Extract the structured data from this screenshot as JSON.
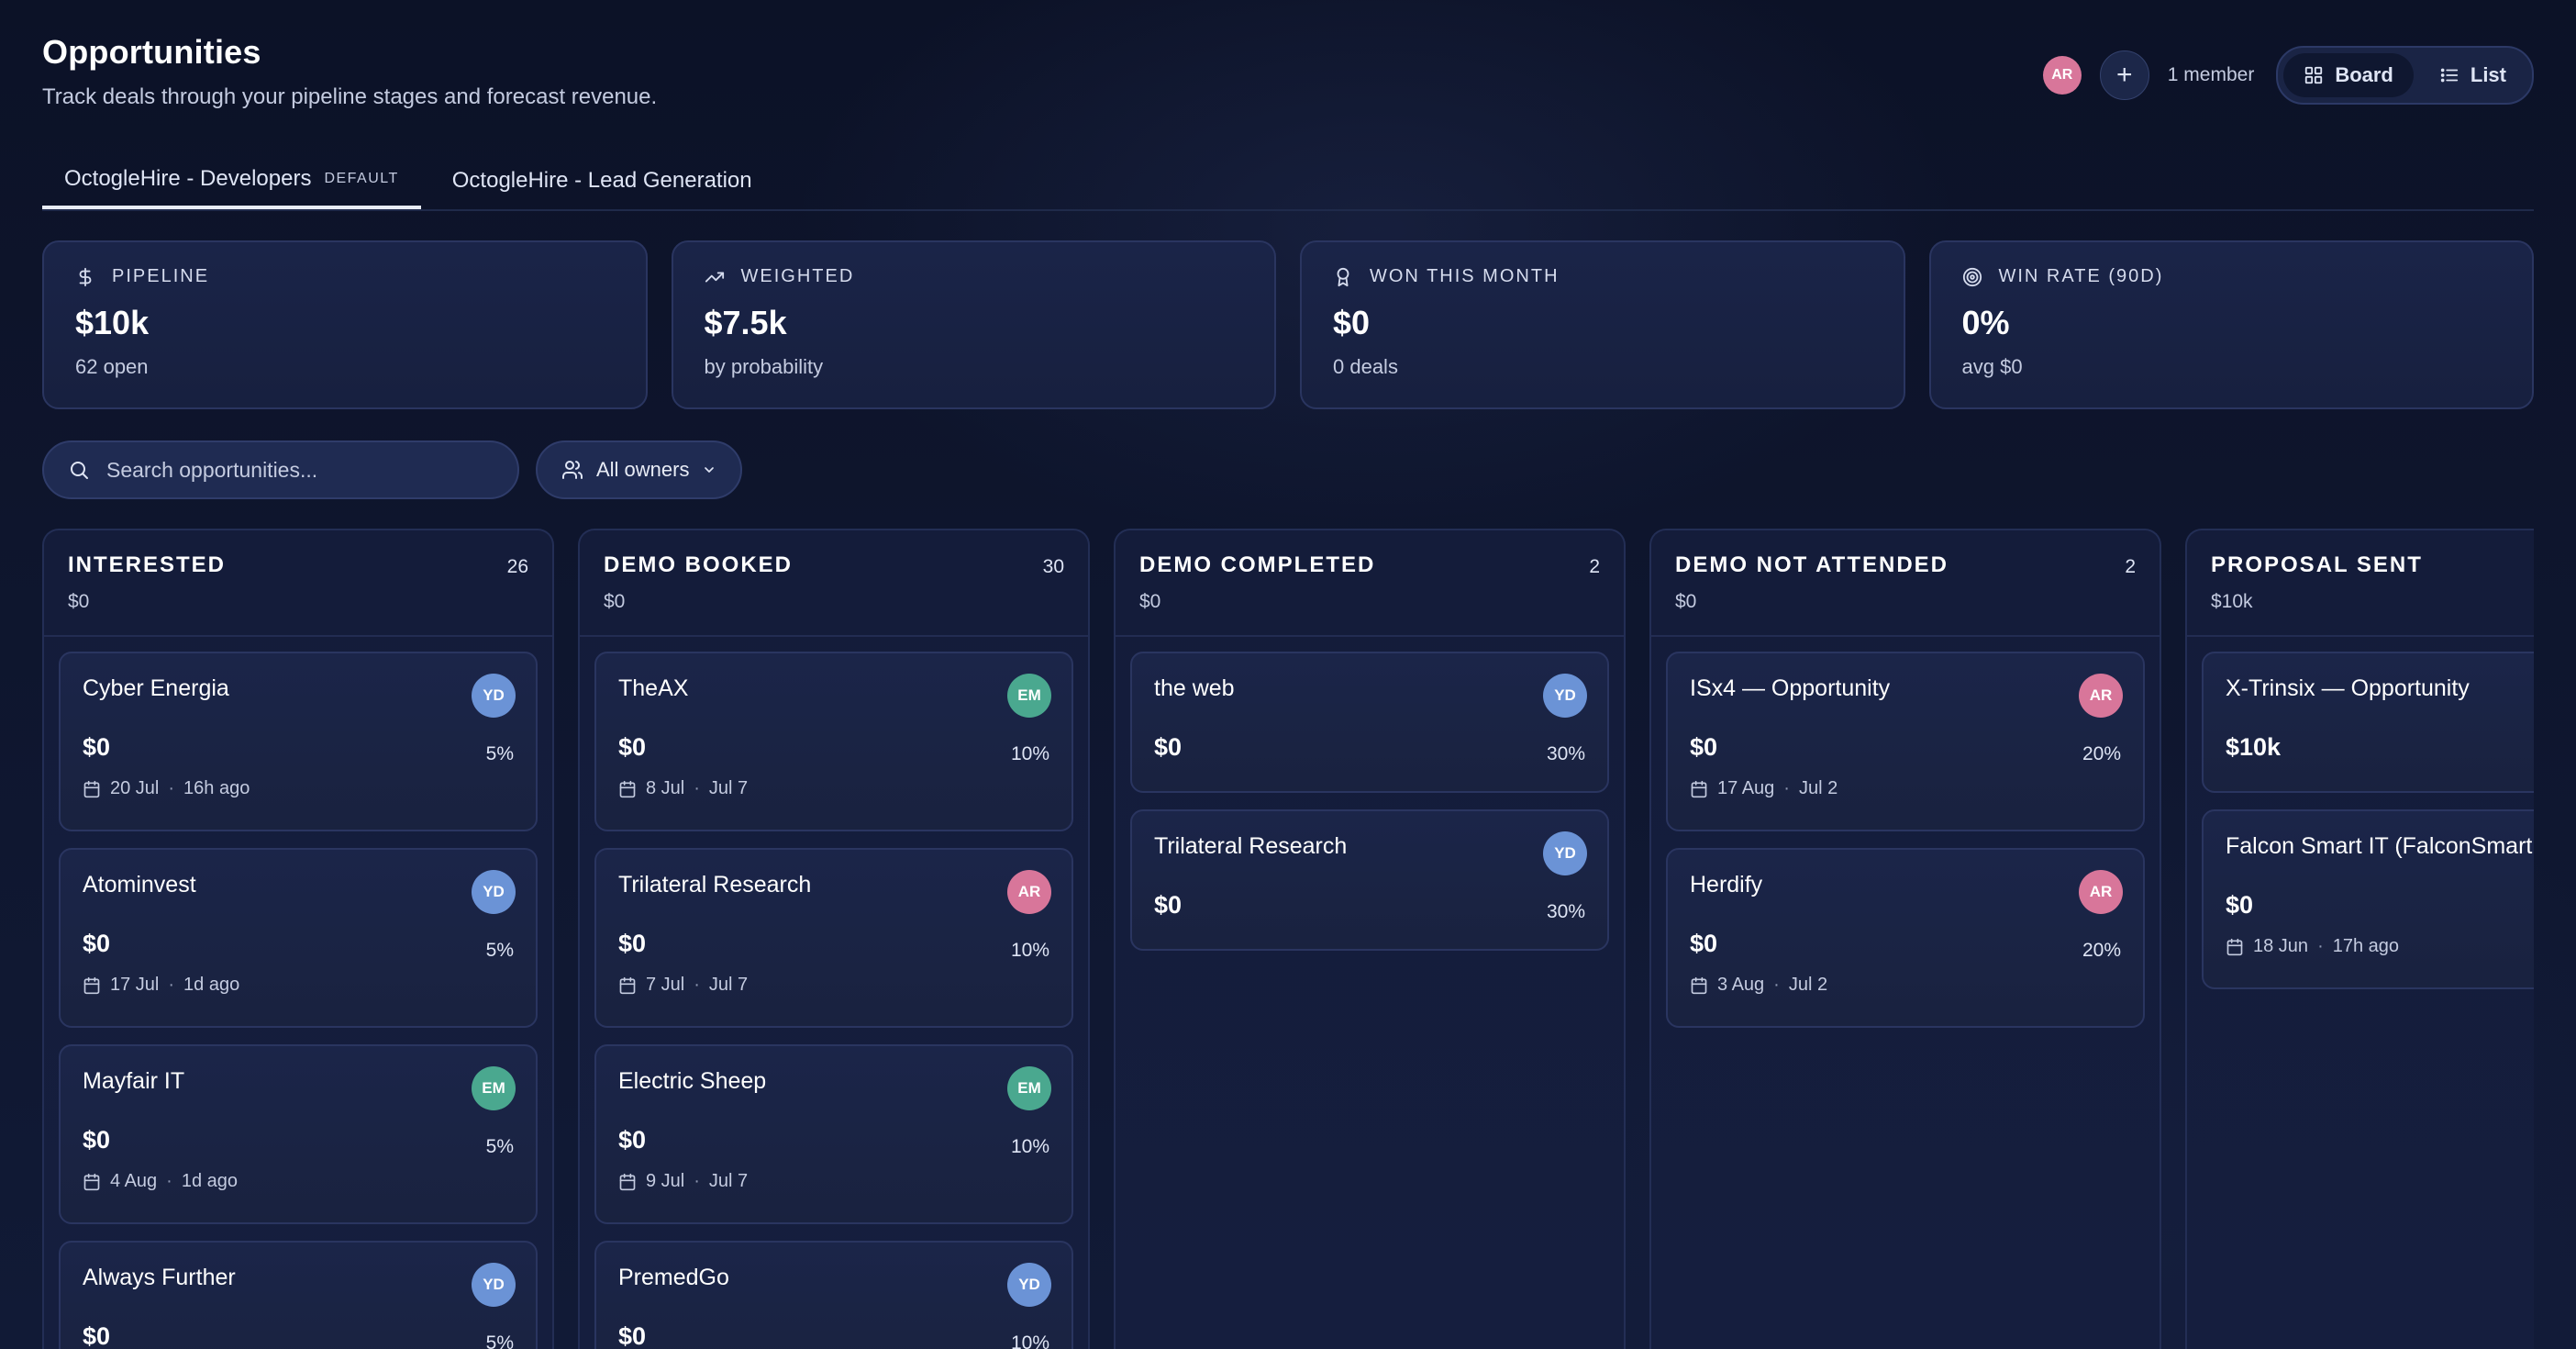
{
  "header": {
    "title": "Opportunities",
    "subtitle": "Track deals through your pipeline stages and forecast revenue.",
    "avatar": "AR",
    "add_member_label": "+",
    "member_count": "1 member",
    "views": {
      "board": "Board",
      "list": "List",
      "active": "board"
    }
  },
  "tabs": [
    {
      "label": "OctogleHire - Developers",
      "badge": "DEFAULT",
      "active": true
    },
    {
      "label": "OctogleHire - Lead Generation",
      "badge": "",
      "active": false
    }
  ],
  "stats": [
    {
      "icon": "dollar-icon",
      "label": "PIPELINE",
      "value": "$10k",
      "sub": "62 open"
    },
    {
      "icon": "trending-up-icon",
      "label": "WEIGHTED",
      "value": "$7.5k",
      "sub": "by probability"
    },
    {
      "icon": "award-icon",
      "label": "WON THIS MONTH",
      "value": "$0",
      "sub": "0 deals"
    },
    {
      "icon": "target-icon",
      "label": "WIN RATE (90D)",
      "value": "0%",
      "sub": "avg $0"
    }
  ],
  "filters": {
    "search_placeholder": "Search opportunities...",
    "owner_filter": "All owners"
  },
  "colors": {
    "AR": "#d8769a",
    "YD": "#6b93d6",
    "EM": "#4aa88f"
  },
  "columns": [
    {
      "title": "INTERESTED",
      "count": "26",
      "total": "$0",
      "cards": [
        {
          "title": "Cyber Energia",
          "owner": "YD",
          "amount": "$0",
          "prob": "5%",
          "date": "20 Jul",
          "meta": "16h ago"
        },
        {
          "title": "Atominvest",
          "owner": "YD",
          "amount": "$0",
          "prob": "5%",
          "date": "17 Jul",
          "meta": "1d ago"
        },
        {
          "title": "Mayfair IT",
          "owner": "EM",
          "amount": "$0",
          "prob": "5%",
          "date": "4 Aug",
          "meta": "1d ago"
        },
        {
          "title": "Always Further",
          "owner": "YD",
          "amount": "$0",
          "prob": "5%",
          "date": "",
          "meta": ""
        }
      ]
    },
    {
      "title": "DEMO BOOKED",
      "count": "30",
      "total": "$0",
      "cards": [
        {
          "title": "TheAX",
          "owner": "EM",
          "amount": "$0",
          "prob": "10%",
          "date": "8 Jul",
          "meta": "Jul 7"
        },
        {
          "title": "Trilateral Research",
          "owner": "AR",
          "amount": "$0",
          "prob": "10%",
          "date": "7 Jul",
          "meta": "Jul 7"
        },
        {
          "title": "Electric Sheep",
          "owner": "EM",
          "amount": "$0",
          "prob": "10%",
          "date": "9 Jul",
          "meta": "Jul 7"
        },
        {
          "title": "PremedGo",
          "owner": "YD",
          "amount": "$0",
          "prob": "10%",
          "date": "",
          "meta": ""
        }
      ]
    },
    {
      "title": "DEMO COMPLETED",
      "count": "2",
      "total": "$0",
      "cards": [
        {
          "title": "the web",
          "owner": "YD",
          "amount": "$0",
          "prob": "30%",
          "date": "",
          "meta": ""
        },
        {
          "title": "Trilateral Research",
          "owner": "YD",
          "amount": "$0",
          "prob": "30%",
          "date": "",
          "meta": ""
        }
      ]
    },
    {
      "title": "DEMO NOT ATTENDED",
      "count": "2",
      "total": "$0",
      "cards": [
        {
          "title": "ISx4 — Opportunity",
          "owner": "AR",
          "amount": "$0",
          "prob": "20%",
          "date": "17 Aug",
          "meta": "Jul 2"
        },
        {
          "title": "Herdify",
          "owner": "AR",
          "amount": "$0",
          "prob": "20%",
          "date": "3 Aug",
          "meta": "Jul 2"
        }
      ]
    },
    {
      "title": "PROPOSAL SENT",
      "count": "",
      "total": "$10k",
      "cards": [
        {
          "title": "X-Trinsix — Opportunity",
          "owner": "",
          "amount": "$10k",
          "prob": "",
          "date": "",
          "meta": ""
        },
        {
          "title": "Falcon Smart IT (FalconSmart",
          "owner": "",
          "amount": "$0",
          "prob": "",
          "date": "18 Jun",
          "meta": "17h ago"
        }
      ]
    }
  ]
}
